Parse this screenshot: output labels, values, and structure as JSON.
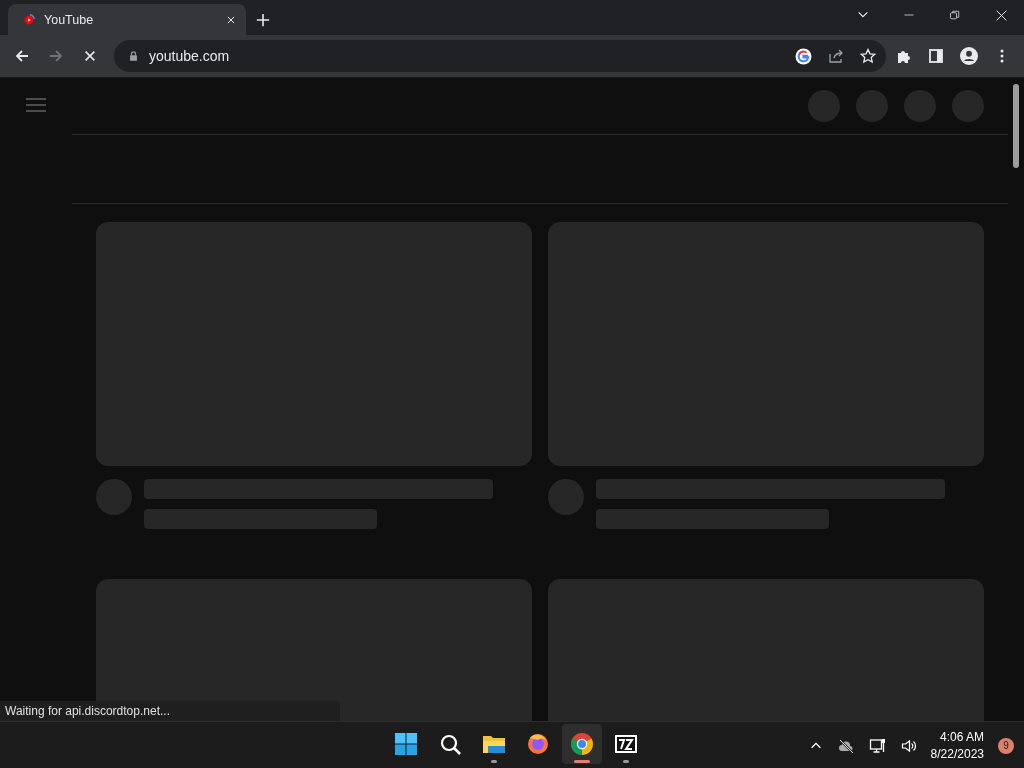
{
  "tab": {
    "title": "YouTube",
    "selected": true
  },
  "toolbar": {
    "nav_buttons": [
      {
        "kind": "back",
        "disabled": false
      },
      {
        "kind": "forward",
        "disabled": true
      },
      {
        "kind": "stop",
        "disabled": false
      }
    ],
    "url": "youtube.com"
  },
  "status_bubble": "Waiting for api.discordtop.net...",
  "taskbar": {
    "apps": [
      {
        "kind": "start",
        "selected": false,
        "running": false
      },
      {
        "kind": "search",
        "selected": false,
        "running": false
      },
      {
        "kind": "files",
        "selected": false,
        "running": true
      },
      {
        "kind": "firefox",
        "selected": false,
        "running": false
      },
      {
        "kind": "chrome",
        "selected": true,
        "running": true
      },
      {
        "kind": "archiver",
        "selected": false,
        "running": true
      }
    ],
    "time": "4:06 AM",
    "date": "8/22/2023",
    "notifications": "9"
  }
}
